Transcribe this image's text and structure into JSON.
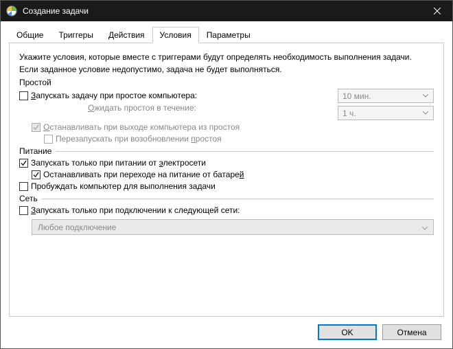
{
  "window": {
    "title": "Создание задачи"
  },
  "tabs": {
    "general": "Общие",
    "triggers": "Триггеры",
    "actions": "Действия",
    "conditions": "Условия",
    "settings": "Параметры"
  },
  "description": {
    "line1": "Укажите условия, которые вместе с триггерами будут определять необходимость выполнения задачи.",
    "line2": "Если заданное условие недопустимо, задача не будет выполняться."
  },
  "idle": {
    "group": "Простой",
    "start_prefix": "З",
    "start_rest": "апускать задачу при простое компьютера:",
    "wait_prefix": "О",
    "wait_rest": "жидать простоя в течение:",
    "stop_prefix": "О",
    "stop_rest": "станавливать при выходе компьютера из простоя",
    "restart_prefix": "п",
    "restart_before": "Перезапускать при возобновлении ",
    "restart_after": "ростоя",
    "duration": "10 мин.",
    "wait_value": "1 ч."
  },
  "power": {
    "group": "Питание",
    "ac_prefix": "э",
    "ac_before": "Запускать только при питании от ",
    "ac_after": "лектросети",
    "battery_prefix": "й",
    "battery_before": "Останавливать при переходе на питание от батаре",
    "battery_after": "",
    "wake": "Пробуждать компьютер для выполнения задачи"
  },
  "network": {
    "group": "Сеть",
    "only_prefix": "З",
    "only_rest": "апускать только при подключении к следующей сети:",
    "any": "Любое подключение"
  },
  "buttons": {
    "ok": "OK",
    "cancel": "Отмена"
  }
}
